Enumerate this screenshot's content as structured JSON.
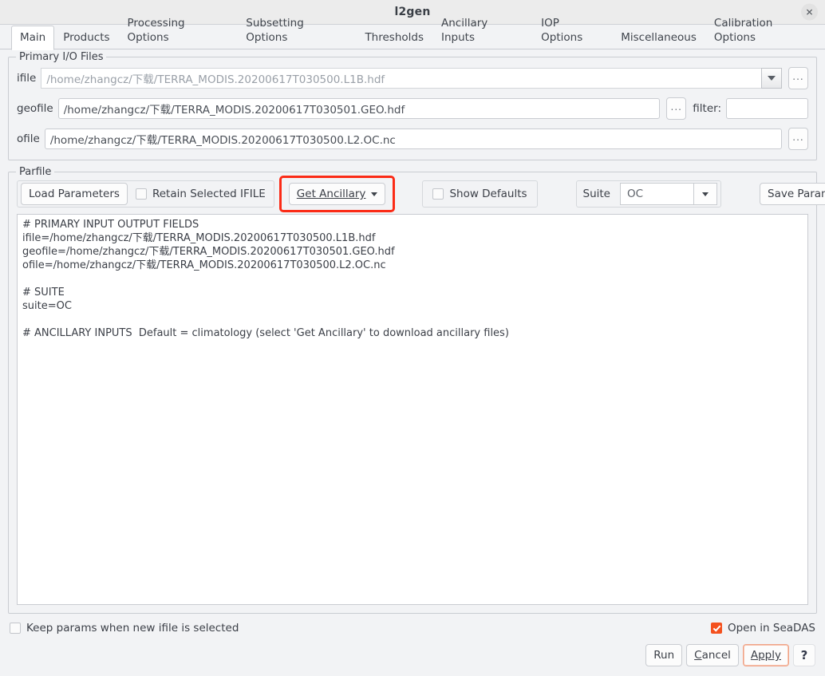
{
  "window": {
    "title": "l2gen",
    "close_label": "✕"
  },
  "tabs": [
    {
      "label": "Main",
      "active": true
    },
    {
      "label": "Products",
      "active": false
    },
    {
      "label": "Processing Options",
      "active": false
    },
    {
      "label": "Subsetting Options",
      "active": false
    },
    {
      "label": "Thresholds",
      "active": false
    },
    {
      "label": "Ancillary Inputs",
      "active": false
    },
    {
      "label": "IOP Options",
      "active": false
    },
    {
      "label": "Miscellaneous",
      "active": false
    },
    {
      "label": "Calibration Options",
      "active": false
    }
  ],
  "primary_io": {
    "legend": "Primary I/O Files",
    "ifile": {
      "label": "ifile",
      "value": "/home/zhangcz/下载/TERRA_MODIS.20200617T030500.L1B.hdf",
      "browse_label": "..."
    },
    "geofile": {
      "label": "geofile",
      "value": "/home/zhangcz/下载/TERRA_MODIS.20200617T030501.GEO.hdf",
      "browse_label": "..."
    },
    "filter": {
      "label": "filter:",
      "value": "",
      "placeholder": ""
    },
    "ofile": {
      "label": "ofile",
      "value": "/home/zhangcz/下载/TERRA_MODIS.20200617T030500.L2.OC.nc",
      "browse_label": "..."
    }
  },
  "parfile": {
    "legend": "Parfile",
    "load_parameters_label": "Load Parameters",
    "retain_selected_ifile": {
      "label": "Retain Selected IFILE",
      "checked": false
    },
    "get_ancillary_label": "Get Ancillary",
    "get_ancillary_highlight_color": "#fb2b16",
    "show_defaults": {
      "label": "Show Defaults",
      "checked": false
    },
    "suite": {
      "label": "Suite",
      "value": "OC"
    },
    "save_parameters_label": "Save Parameters",
    "text": "# PRIMARY INPUT OUTPUT FIELDS\nifile=/home/zhangcz/下载/TERRA_MODIS.20200617T030500.L1B.hdf\ngeofile=/home/zhangcz/下载/TERRA_MODIS.20200617T030501.GEO.hdf\nofile=/home/zhangcz/下载/TERRA_MODIS.20200617T030500.L2.OC.nc\n\n# SUITE\nsuite=OC\n\n# ANCILLARY INPUTS  Default = climatology (select 'Get Ancillary' to download ancillary files)"
  },
  "footer": {
    "keep_params": {
      "label": "Keep params when new ifile is selected",
      "checked": false
    },
    "open_in_seadas": {
      "label": "Open in SeaDAS",
      "checked": true,
      "color": "#f4511e"
    },
    "run_label": "Run",
    "cancel_label": "Cancel",
    "apply_label": "Apply",
    "help_label": "?"
  }
}
